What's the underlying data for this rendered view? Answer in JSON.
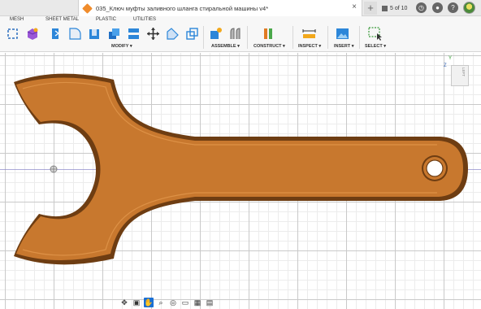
{
  "window": {
    "document_title": "035_Ключ муфты заливного шланга стиральной машины v4*",
    "close_glyph": "×",
    "new_tab_glyph": "+",
    "tabs_count": "5 of 10"
  },
  "ribbon": {
    "tabs": [
      "MESH",
      "SHEET METAL",
      "PLASTIC",
      "UTILITIES"
    ],
    "groups": {
      "modify": "MODIFY ▾",
      "assemble": "ASSEMBLE ▾",
      "construct": "CONSTRUCT ▾",
      "inspect": "INSPECT ▾",
      "insert": "INSERT ▾",
      "select": "SELECT ▾"
    }
  },
  "viewcube": {
    "face_label": "LEFT",
    "axis_z": "Z",
    "axis_y": "Y"
  },
  "colors": {
    "part_fill": "#c8782e",
    "part_edge": "#6e3d12",
    "accent": "#1a6fd4",
    "grid_major": "#c9c9c9",
    "grid_minor": "#ececec"
  },
  "navigation_bar": {
    "icons": [
      "orbit-icon",
      "camera-icon",
      "pan-hand-icon",
      "zoom-icon",
      "zoom-window-icon",
      "display-mode-icon",
      "grid-icon",
      "viewports-icon"
    ]
  }
}
